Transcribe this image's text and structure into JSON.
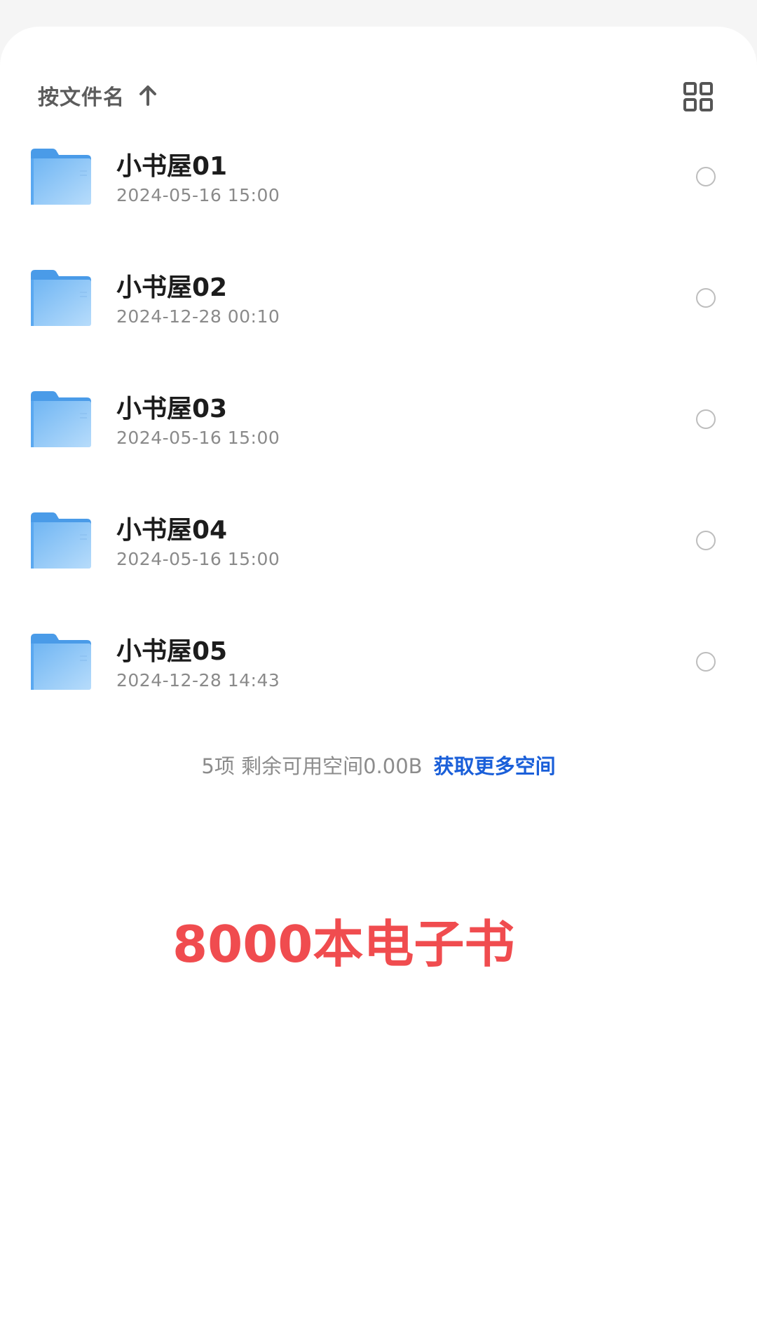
{
  "toolbar": {
    "sort_label": "按文件名",
    "sort_direction_icon": "arrow-up-icon",
    "view_toggle_icon": "grid-view-icon"
  },
  "files": [
    {
      "name": "小书屋01",
      "date": "2024-05-16 15:00",
      "icon": "folder-icon"
    },
    {
      "name": "小书屋02",
      "date": "2024-12-28 00:10",
      "icon": "folder-icon"
    },
    {
      "name": "小书屋03",
      "date": "2024-05-16 15:00",
      "icon": "folder-icon"
    },
    {
      "name": "小书屋04",
      "date": "2024-05-16 15:00",
      "icon": "folder-icon"
    },
    {
      "name": "小书屋05",
      "date": "2024-12-28 14:43",
      "icon": "folder-icon"
    }
  ],
  "footer": {
    "info": "5项 剩余可用空间0.00B",
    "link": "获取更多空间"
  },
  "promo": "8000本电子书",
  "colors": {
    "accent_link": "#1a5fd9",
    "promo_red": "#f04c4f",
    "folder_blue": "#5aa8f0"
  }
}
